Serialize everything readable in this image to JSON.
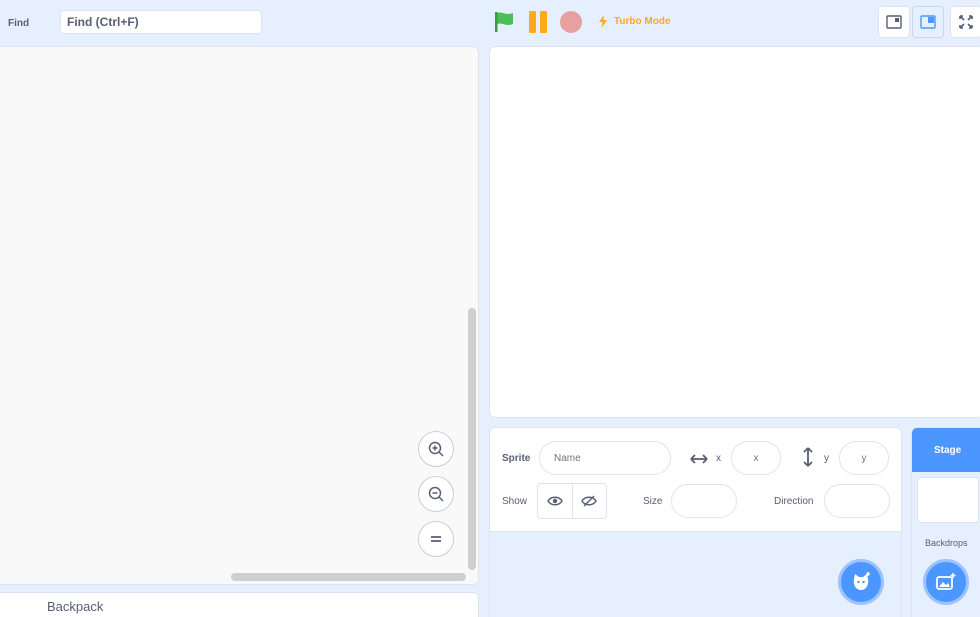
{
  "find": {
    "label": "Find",
    "placeholder": "Find (Ctrl+F)"
  },
  "controls": {
    "turbo_label": "Turbo Mode"
  },
  "workspace": {
    "backpack_label": "Backpack"
  },
  "sprite_info": {
    "sprite_label": "Sprite",
    "name_placeholder": "Name",
    "x_label": "x",
    "x_placeholder": "x",
    "y_label": "y",
    "y_placeholder": "y",
    "show_label": "Show",
    "size_label": "Size",
    "direction_label": "Direction"
  },
  "stage_pane": {
    "title": "Stage",
    "backdrops_label": "Backdrops"
  },
  "colors": {
    "accent": "#4c97ff",
    "flag": "#4cbf56",
    "pause": "#ffab19",
    "stop": "#e6a0a0"
  }
}
